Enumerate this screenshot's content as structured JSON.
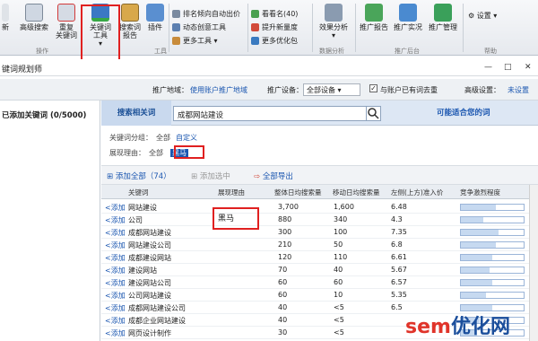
{
  "ribbon": {
    "btn_new": "新",
    "btn_adv_search": "高级搜索",
    "btn_repeat_line1": "重复",
    "btn_repeat_line2": "关键词",
    "btn_kwtool_line1": "关键词",
    "btn_kwtool_line2": "工具",
    "btn_report_line1": "搜索词",
    "btn_report_line2": "报告",
    "btn_plugin": "插件",
    "menu_rank": "排名倾向自动出价",
    "menu_creative": "动态创意工具",
    "menu_more": "更多工具",
    "menu_watchlist": "看看名(40)",
    "menu_newvolume": "提升新量度",
    "menu_moreopt": "更多优化包",
    "btn_effect": "效果分析",
    "btn_promo_report": "推广报告",
    "btn_promo_real": "推广实况",
    "btn_promo_manage": "推广管理",
    "btn_settings": "设置",
    "grp_ops": "操作",
    "grp_tools": "工具",
    "grp_analysis": "数据分析",
    "grp_promo": "推广后台",
    "grp_help": "帮助"
  },
  "window": {
    "title": "键词规划师",
    "min": "—",
    "max": "□",
    "close": "✕"
  },
  "options": {
    "region_label": "推广地域：",
    "region_value": "使用账户推广地域",
    "device_label": "推广设备：",
    "device_value": "全部设备",
    "dedupe_label": "与账户已有词去重",
    "adv_label": "高级设置：",
    "adv_value": "未设置"
  },
  "left_panel": {
    "title": "已添加关键词 (0/5000)"
  },
  "tabs": {
    "tab1": "搜索相关词",
    "search_value": "成都网站建设",
    "tab2": "可能适合您的词"
  },
  "filters": {
    "group_label": "关键词分组：",
    "group_all": "全部",
    "group_custom": "自定义",
    "reason_label": "展现理由：",
    "reason_all": "全部",
    "reason_tag": "黑马"
  },
  "toolbar": {
    "add_all": "添加全部（74）",
    "add_selected": "添加选中",
    "export_all": "全部导出"
  },
  "table": {
    "headers": [
      "关键词",
      "展现理由",
      "整体日均搜索量",
      "移动日均搜索量",
      "左侧(上方)准入价",
      "竞争激烈程度"
    ],
    "add_label": "<添加",
    "rows": [
      {
        "kw": "网站建设",
        "reason": "",
        "total": "3,700",
        "mobile": "1,600",
        "price": "6.48",
        "comp": 0.55
      },
      {
        "kw": "公司",
        "reason": "黑马",
        "total": "880",
        "mobile": "340",
        "price": "4.3",
        "comp": 0.35
      },
      {
        "kw": "成都网站建设",
        "reason": "",
        "total": "300",
        "mobile": "100",
        "price": "7.35",
        "comp": 0.6
      },
      {
        "kw": "网站建设公司",
        "reason": "",
        "total": "210",
        "mobile": "50",
        "price": "6.8",
        "comp": 0.55
      },
      {
        "kw": "成都建设网站",
        "reason": "",
        "total": "120",
        "mobile": "110",
        "price": "6.61",
        "comp": 0.5
      },
      {
        "kw": "建设网站",
        "reason": "",
        "total": "70",
        "mobile": "40",
        "price": "5.67",
        "comp": 0.45
      },
      {
        "kw": "建设网站公司",
        "reason": "",
        "total": "60",
        "mobile": "60",
        "price": "6.57",
        "comp": 0.5
      },
      {
        "kw": "公司网站建设",
        "reason": "",
        "total": "60",
        "mobile": "10",
        "price": "5.35",
        "comp": 0.4
      },
      {
        "kw": "成都网站建设公司",
        "reason": "",
        "total": "40",
        "mobile": "<5",
        "price": "6.5",
        "comp": 0.5
      },
      {
        "kw": "成都企业网站建设",
        "reason": "",
        "total": "40",
        "mobile": "<5",
        "price": "",
        "comp": 0.3
      },
      {
        "kw": "网页设计制作",
        "reason": "",
        "total": "30",
        "mobile": "<5",
        "price": "",
        "comp": 0.25
      }
    ]
  },
  "watermark": {
    "part1": "sem",
    "part2": "优化网"
  },
  "colors": {
    "highlight": "#e02020",
    "link": "#1a56b0",
    "bar": "#c6d9f0"
  }
}
